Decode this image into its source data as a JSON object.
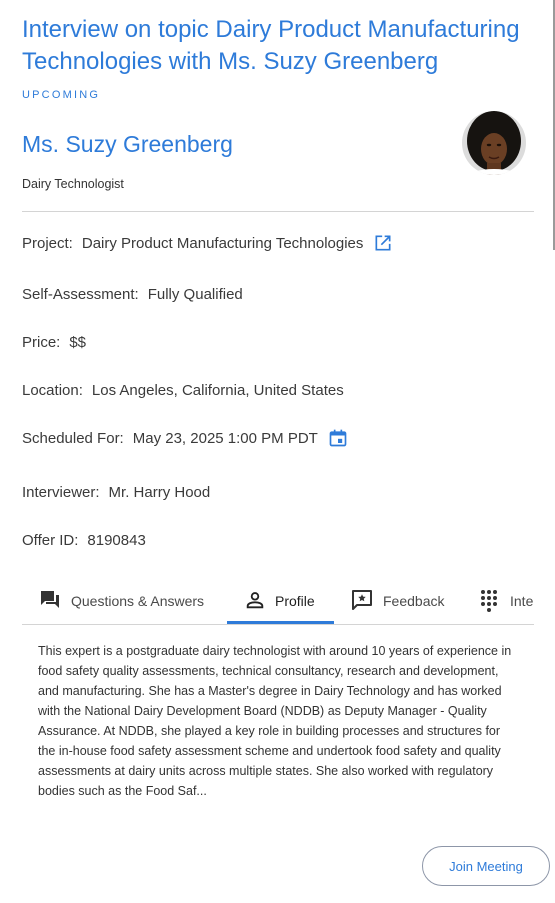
{
  "interview": {
    "title": "Interview on topic Dairy Product Manufacturing Technologies with Ms. Suzy Greenberg",
    "status": "UPCOMING"
  },
  "expert": {
    "name": "Ms. Suzy Greenberg",
    "role": "Dairy Technologist",
    "avatar_alt": "expert portrait photo"
  },
  "details": {
    "project_label": "Project:",
    "project_value": "Dairy Product Manufacturing Technologies",
    "self_assessment_label": "Self-Assessment:",
    "self_assessment_value": "Fully Qualified",
    "price_label": "Price:",
    "price_value": "$$",
    "location_label": "Location:",
    "location_value": "Los Angeles, California, United States",
    "scheduled_label": "Scheduled For:",
    "scheduled_value": "May 23, 2025 1:00 PM PDT",
    "interviewer_label": "Interviewer:",
    "interviewer_value": "Mr. Harry Hood",
    "offer_label": "Offer ID:",
    "offer_value": "8190843"
  },
  "tabs": [
    {
      "label": "Questions & Answers",
      "icon": "forum-icon",
      "active": false
    },
    {
      "label": "Profile",
      "icon": "person-icon",
      "active": true
    },
    {
      "label": "Feedback",
      "icon": "feedback-icon",
      "active": false
    },
    {
      "label": "Inte",
      "icon": "dialpad-icon",
      "active": false
    }
  ],
  "profile": {
    "bio": "This expert is a postgraduate dairy technologist with around 10 years of experience in food safety quality assessments, technical consultancy, research and development, and manufacturing. She has a Master's degree in Dairy Technology and has worked with the National Dairy Development Board (NDDB) as Deputy Manager - Quality Assurance. At NDDB, she played a key role in building processes and structures for the in-house food safety assessment scheme and undertook food safety and quality assessments at dairy units across multiple states. She also worked with regulatory bodies such as the Food Saf..."
  },
  "actions": {
    "join_meeting": "Join Meeting"
  },
  "colors": {
    "accent": "#2e7bd9",
    "text": "#3a3a3a",
    "divider": "#d4d4d4"
  }
}
